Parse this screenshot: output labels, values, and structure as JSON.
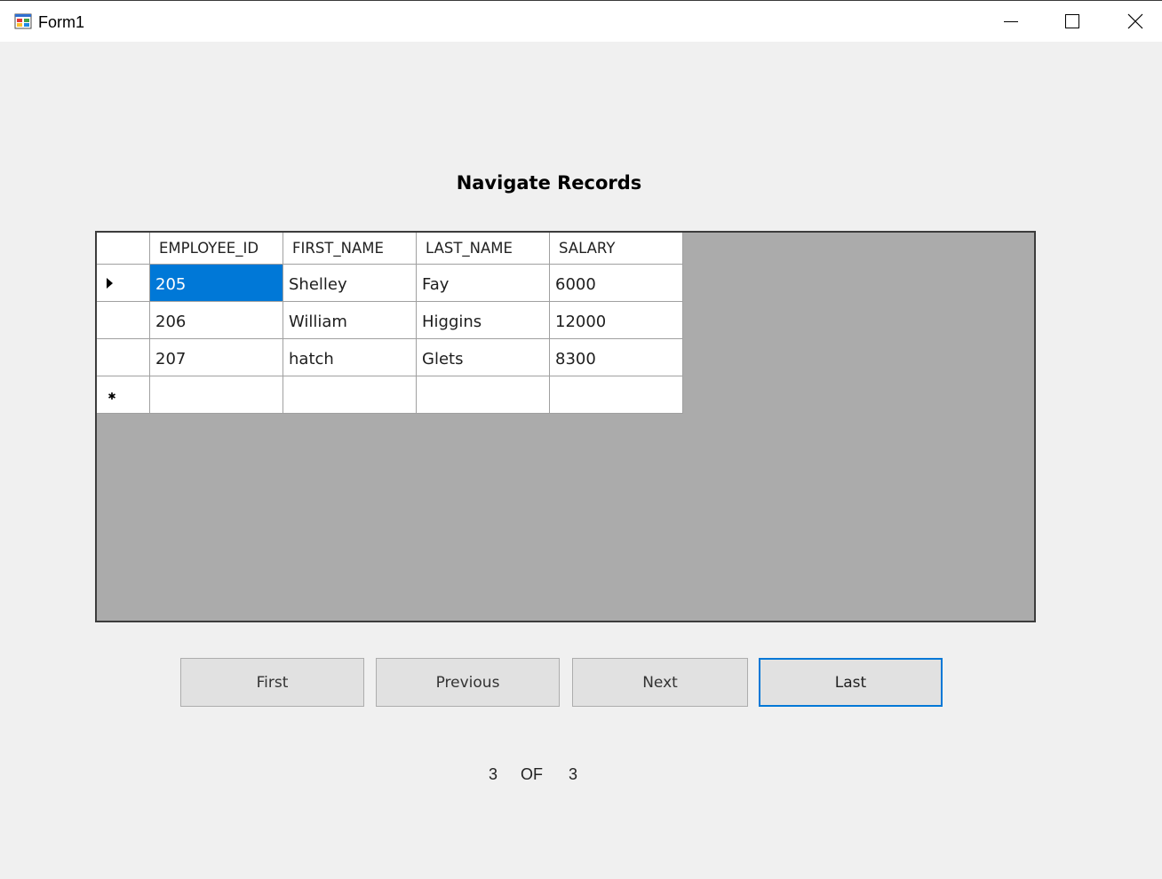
{
  "window": {
    "title": "Form1",
    "icon": "winforms-app-icon",
    "controls": [
      "minimize-icon",
      "maximize-icon",
      "close-icon"
    ]
  },
  "heading": "Navigate Records",
  "grid": {
    "columns": [
      "EMPLOYEE_ID",
      "FIRST_NAME",
      "LAST_NAME",
      "SALARY"
    ],
    "rows": [
      {
        "EMPLOYEE_ID": "205",
        "FIRST_NAME": "Shelley",
        "LAST_NAME": "Fay",
        "SALARY": "6000"
      },
      {
        "EMPLOYEE_ID": "206",
        "FIRST_NAME": "William",
        "LAST_NAME": "Higgins",
        "SALARY": "12000"
      },
      {
        "EMPLOYEE_ID": "207",
        "FIRST_NAME": "hatch",
        "LAST_NAME": "Glets",
        "SALARY": "8300"
      }
    ],
    "current_row_marker": "row-pointer-icon",
    "new_row_marker": "new-row-asterisk-icon",
    "selection_color": "#0078d7",
    "background_color": "#ababab"
  },
  "buttons": {
    "first": "First",
    "previous": "Previous",
    "next": "Next",
    "last": "Last"
  },
  "position": {
    "current": "3",
    "of_label": "OF",
    "total": "3"
  }
}
